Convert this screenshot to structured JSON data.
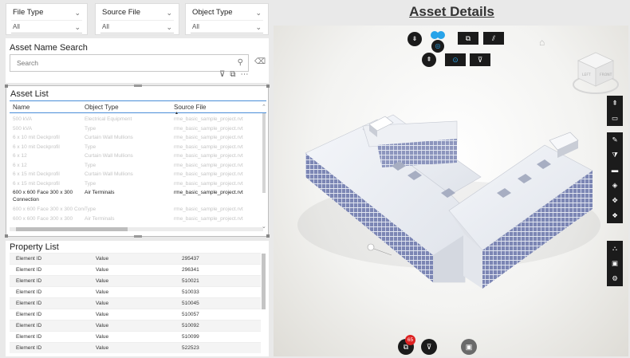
{
  "filters": [
    {
      "label": "File Type",
      "value": "All"
    },
    {
      "label": "Source File",
      "value": "All"
    },
    {
      "label": "Object Type",
      "value": "All"
    }
  ],
  "search": {
    "title": "Asset Name Search",
    "placeholder": "Search"
  },
  "asset_list": {
    "title": "Asset List",
    "columns": [
      "Name",
      "Object Type",
      "Source File"
    ],
    "rows": [
      {
        "name": "500 kVA",
        "type": "Electrical Equipment",
        "source": "rme_basic_sample_project.rvt",
        "active": false
      },
      {
        "name": "500 kVA",
        "type": "Type",
        "source": "rme_basic_sample_project.rvt",
        "active": false
      },
      {
        "name": "6 x 10 mit Deckprofil",
        "type": "Curtain Wall Mullions",
        "source": "rme_basic_sample_project.rvt",
        "active": false
      },
      {
        "name": "6 x 10 mit Deckprofil",
        "type": "Type",
        "source": "rme_basic_sample_project.rvt",
        "active": false
      },
      {
        "name": "6 x 12",
        "type": "Curtain Wall Mullions",
        "source": "rme_basic_sample_project.rvt",
        "active": false
      },
      {
        "name": "6 x 12",
        "type": "Type",
        "source": "rme_basic_sample_project.rvt",
        "active": false
      },
      {
        "name": "6 x 15 mit Deckprofil",
        "type": "Curtain Wall Mullions",
        "source": "rme_basic_sample_project.rvt",
        "active": false
      },
      {
        "name": "6 x 15 mit Deckprofil",
        "type": "Type",
        "source": "rme_basic_sample_project.rvt",
        "active": false
      },
      {
        "name": "600 x 600 Face 300 x 300 Connection",
        "type": "Air Terminals",
        "source": "rme_basic_sample_project.rvt",
        "active": true
      },
      {
        "name": "600 x 600 Face 300 x 300 Connection",
        "type": "Type",
        "source": "rme_basic_sample_project.rvt",
        "active": false
      },
      {
        "name": "600 x 600 Face 300 x 300",
        "type": "Air Terminals",
        "source": "rme_basic_sample_project.rvt",
        "active": false
      }
    ]
  },
  "property_list": {
    "title": "Property List",
    "rows": [
      {
        "property": "Element ID",
        "label": "Value",
        "value": "295437"
      },
      {
        "property": "Element ID",
        "label": "Value",
        "value": "296341"
      },
      {
        "property": "Element ID",
        "label": "Value",
        "value": "510021"
      },
      {
        "property": "Element ID",
        "label": "Value",
        "value": "510033"
      },
      {
        "property": "Element ID",
        "label": "Value",
        "value": "510045"
      },
      {
        "property": "Element ID",
        "label": "Value",
        "value": "510057"
      },
      {
        "property": "Element ID",
        "label": "Value",
        "value": "510092"
      },
      {
        "property": "Element ID",
        "label": "Value",
        "value": "510099"
      },
      {
        "property": "Element ID",
        "label": "Value",
        "value": "522523"
      }
    ]
  },
  "page_title": "Asset Details",
  "viewer": {
    "notification_count": "65",
    "cube_faces": [
      "LEFT",
      "FRONT"
    ],
    "colors": {
      "toolbar_bg": "#1b1b1b",
      "accent_blue": "#27a3e9",
      "badge_red": "#dd2222",
      "glazing": "#6e78a8"
    },
    "top_toolbar_icons": [
      "collapse-up-icon",
      "collapse-down-icon",
      "orbit-blue-icon",
      "copy-layers-icon",
      "hatch-icon",
      "focus-target-icon",
      "filter-icon"
    ],
    "side_toolbar_icons": [
      "walk-icon",
      "camera-icon",
      "measure-pencil-icon",
      "section-icon",
      "folder-icon",
      "model-layers-icon",
      "explode-icon",
      "settings-model-icon",
      "structure-icon",
      "properties-icon",
      "gear-icon"
    ],
    "bottom_icons": [
      "layers-badge-icon",
      "filter-clear-icon",
      "save-icon"
    ]
  }
}
